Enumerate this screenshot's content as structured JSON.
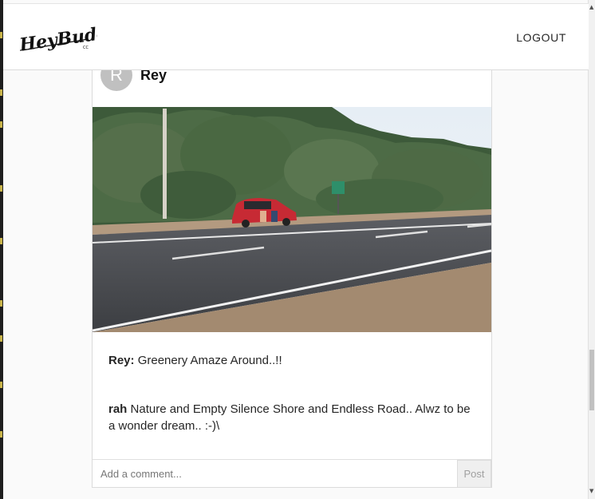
{
  "navbar": {
    "brand": "HeyBuddy",
    "brand_suffix": "CC",
    "logout_label": "LOGOUT"
  },
  "post": {
    "avatar_initial": "R",
    "author": "Rey",
    "comments": [
      {
        "user": "Rey:",
        "text": "Greenery Amaze Around..!!"
      },
      {
        "user": "rah",
        "text": "Nature and Empty Silence Shore and Endless Road.. Alwz to be a wonder dream.. :-)\\"
      }
    ],
    "comment_placeholder": "Add a comment...",
    "post_label": "Post"
  },
  "colors": {
    "page_bg": "#fafafa",
    "card_border": "#dbdbdb",
    "avatar_bg": "#c0c0c0"
  },
  "icons": [
    "scroll-up-arrow-icon",
    "scroll-down-arrow-icon"
  ]
}
